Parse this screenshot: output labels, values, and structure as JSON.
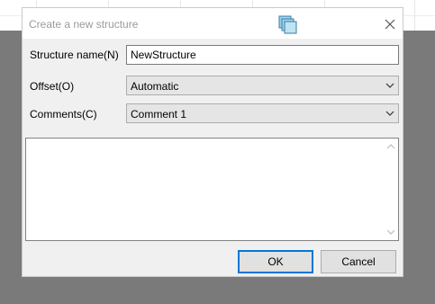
{
  "dialog": {
    "title": "Create a new structure",
    "close_icon": "close-icon",
    "app_icon": "stacked-windows-icon"
  },
  "form": {
    "structure_name_label": "Structure name(N)",
    "structure_name_value": "NewStructure",
    "offset_label": "Offset(O)",
    "offset_value": "Automatic",
    "comments_label": "Comments(C)",
    "comments_value": "Comment 1",
    "comments_text": ""
  },
  "buttons": {
    "ok": "OK",
    "cancel": "Cancel"
  },
  "colors": {
    "backdrop": "#7a7a7a",
    "dialog_bg": "#f0f0f0",
    "default_button_border": "#0078d7",
    "icon_fill": "#9fd3ea",
    "icon_stroke": "#3b7ea6"
  }
}
